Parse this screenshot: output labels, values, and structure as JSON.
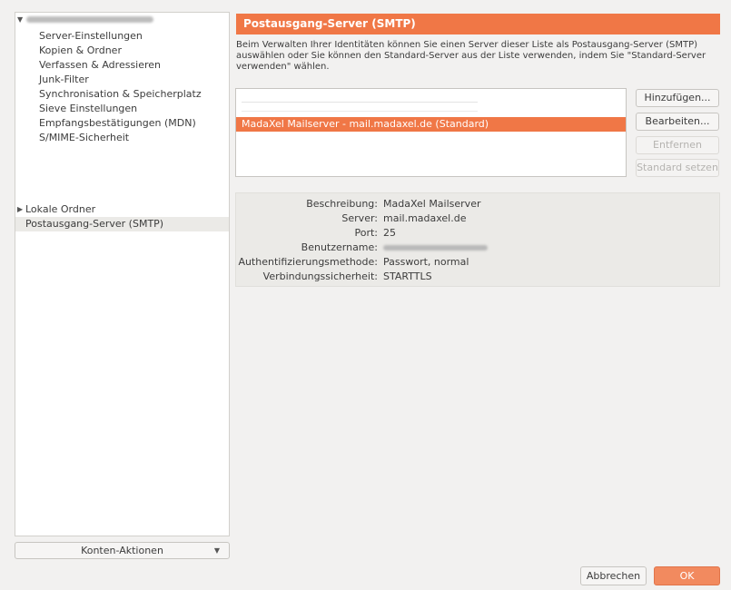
{
  "sidebar": {
    "account_settings": [
      "Server-Einstellungen",
      "Kopien & Ordner",
      "Verfassen & Adressieren",
      "Junk-Filter",
      "Synchronisation & Speicherplatz",
      "Sieve Einstellungen",
      "Empfangsbestätigungen (MDN)",
      "S/MIME-Sicherheit"
    ],
    "local_folders": "Lokale Ordner",
    "outgoing_server": "Postausgang-Server (SMTP)",
    "account_actions": "Konten-Aktionen"
  },
  "main": {
    "header": "Postausgang-Server (SMTP)",
    "description": "Beim Verwalten Ihrer Identitäten können Sie einen Server dieser Liste als Postausgang-Server (SMTP) auswählen oder Sie können den Standard-Server aus der Liste verwenden, indem Sie \"Standard-Server verwenden\" wählen.",
    "servers": [
      "MadaXel Mailserver - mail.madaxel.de (Standard)"
    ],
    "buttons": {
      "add": "Hinzufügen...",
      "edit": "Bearbeiten...",
      "remove": "Entfernen",
      "set_default": "Standard setzen"
    },
    "details": {
      "description_label": "Beschreibung:",
      "description_value": "MadaXel Mailserver",
      "server_label": "Server:",
      "server_value": "mail.madaxel.de",
      "port_label": "Port:",
      "port_value": "25",
      "username_label": "Benutzername:",
      "auth_label": "Authentifizierungsmethode:",
      "auth_value": "Passwort, normal",
      "security_label": "Verbindungssicherheit:",
      "security_value": "STARTTLS"
    }
  },
  "dialog": {
    "cancel": "Abbrechen",
    "ok": "OK"
  },
  "colors": {
    "accent": "#f07746",
    "selection": "#ebeae7"
  }
}
